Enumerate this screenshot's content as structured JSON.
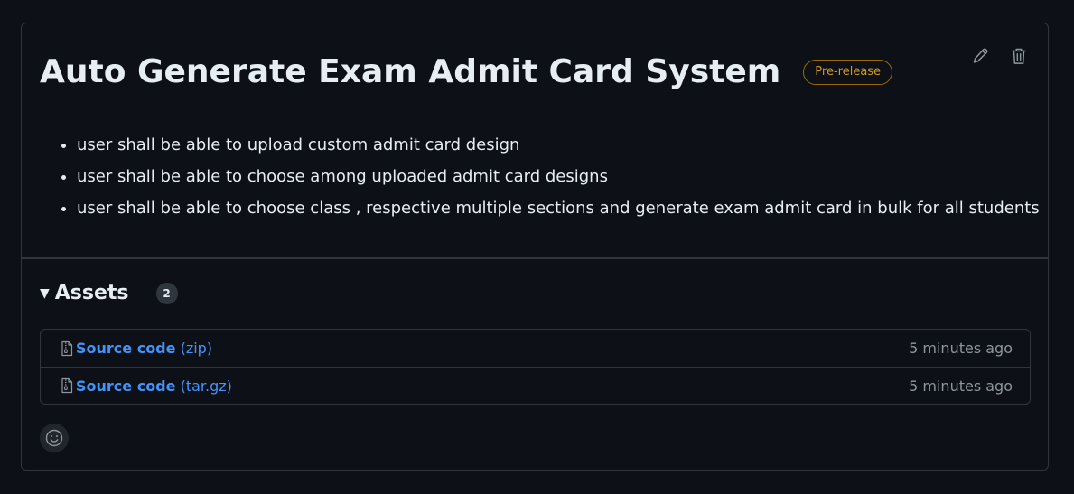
{
  "release": {
    "title": "Auto Generate Exam Admit Card System",
    "badge": "Pre-release",
    "notes": [
      "user shall be able to upload custom admit card design",
      "user shall be able to choose among uploaded admit card designs",
      "user shall be able to choose class , respective multiple sections and generate exam admit card in bulk for all students"
    ]
  },
  "actions": {
    "edit_icon": "pencil-icon",
    "delete_icon": "trash-icon"
  },
  "assets": {
    "title": "Assets",
    "count": "2",
    "items": [
      {
        "name": "Source code",
        "ext": "(zip)",
        "time": "5 minutes ago",
        "icon": "file-zip-icon"
      },
      {
        "name": "Source code",
        "ext": "(tar.gz)",
        "time": "5 minutes ago",
        "icon": "file-zip-icon"
      }
    ]
  },
  "reaction": {
    "icon": "smiley-icon"
  },
  "colors": {
    "background": "#0d1117",
    "border": "#30363d",
    "link": "#4493f8",
    "badge": "#d29922",
    "muted": "#8d96a0"
  }
}
